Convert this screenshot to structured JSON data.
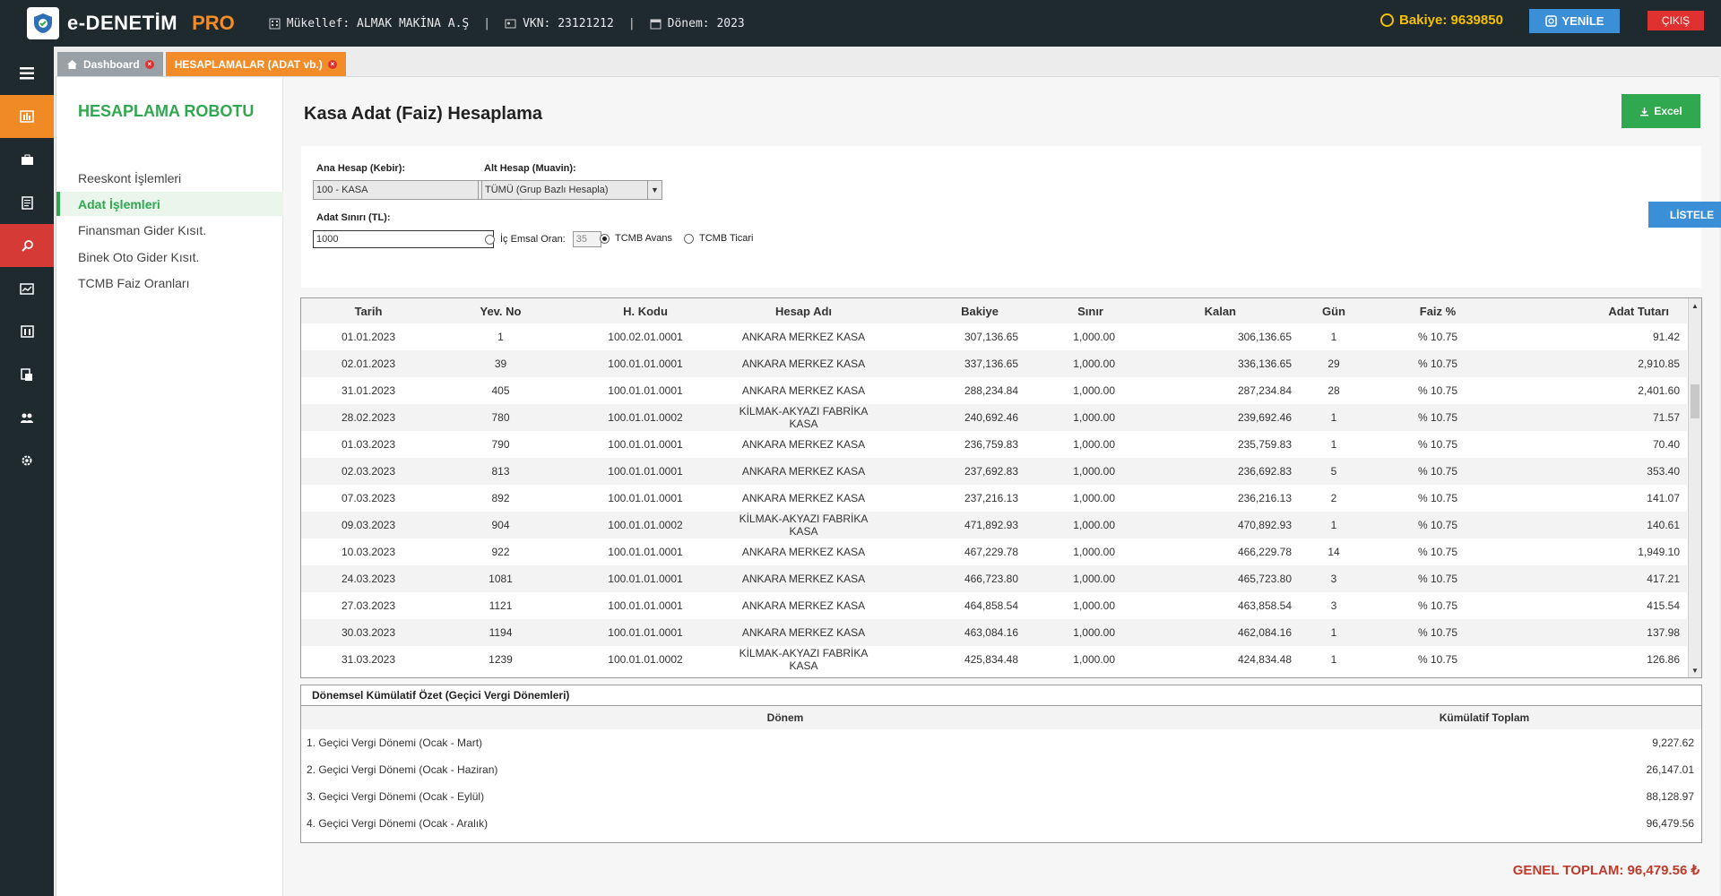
{
  "topbar": {
    "brand": "e-DENETİM",
    "pro": "PRO",
    "mukellef": "Mükellef: ALMAK MAKİNA A.Ş",
    "vkn": "VKN: 23121212",
    "donem": "Dönem: 2023",
    "sep": "|",
    "bakiye": "Bakiye: 9639850",
    "yenile": "YENİLE",
    "cikis": "ÇIKIŞ"
  },
  "tabs": [
    {
      "label": "Dashboard"
    },
    {
      "label": "HESAPLAMALAR (ADAT vb.)"
    }
  ],
  "sidebar": {
    "title": "HESAPLAMA ROBOTU",
    "items": [
      {
        "label": "Reeskont İşlemleri"
      },
      {
        "label": "Adat İşlemleri"
      },
      {
        "label": "Finansman Gider Kısıt."
      },
      {
        "label": "Binek Oto Gider Kısıt."
      },
      {
        "label": "TCMB Faiz Oranları"
      }
    ]
  },
  "main": {
    "title": "Kasa Adat (Faiz) Hesaplama",
    "excel_label": "Excel",
    "listele_label": "LİSTELE"
  },
  "filters": {
    "ana_hesap_label": "Ana Hesap (Kebir):",
    "ana_hesap_value": "100 - KASA",
    "alt_hesap_label": "Alt Hesap (Muavin):",
    "alt_hesap_value": "TÜMÜ (Grup Bazlı Hesapla)",
    "adat_siniri_label": "Adat Sınırı (TL):",
    "adat_siniri_value": "1000",
    "ic_emsal_label": "İç Emsal Oran:",
    "ic_emsal_value": "35",
    "tcmb_avans_label": "TCMB Avans",
    "tcmb_ticari_label": "TCMB Ticari",
    "selected_rate": "TCMB Avans"
  },
  "table": {
    "headers": [
      "Tarih",
      "Yev. No",
      "H. Kodu",
      "Hesap Adı",
      "Bakiye",
      "Sınır",
      "Kalan",
      "Gün",
      "Faiz %",
      "Adat Tutarı"
    ],
    "rows": [
      [
        "01.01.2023",
        "1",
        "100.02.01.0001",
        "ANKARA MERKEZ KASA",
        "307,136.65",
        "1,000.00",
        "306,136.65",
        "1",
        "% 10.75",
        "91.42"
      ],
      [
        "02.01.2023",
        "39",
        "100.01.01.0001",
        "ANKARA MERKEZ KASA",
        "337,136.65",
        "1,000.00",
        "336,136.65",
        "29",
        "% 10.75",
        "2,910.85"
      ],
      [
        "31.01.2023",
        "405",
        "100.01.01.0001",
        "ANKARA MERKEZ KASA",
        "288,234.84",
        "1,000.00",
        "287,234.84",
        "28",
        "% 10.75",
        "2,401.60"
      ],
      [
        "28.02.2023",
        "780",
        "100.01.01.0002",
        "KİLMAK-AKYAZI FABRİKA KASA",
        "240,692.46",
        "1,000.00",
        "239,692.46",
        "1",
        "% 10.75",
        "71.57"
      ],
      [
        "01.03.2023",
        "790",
        "100.01.01.0001",
        "ANKARA MERKEZ KASA",
        "236,759.83",
        "1,000.00",
        "235,759.83",
        "1",
        "% 10.75",
        "70.40"
      ],
      [
        "02.03.2023",
        "813",
        "100.01.01.0001",
        "ANKARA MERKEZ KASA",
        "237,692.83",
        "1,000.00",
        "236,692.83",
        "5",
        "% 10.75",
        "353.40"
      ],
      [
        "07.03.2023",
        "892",
        "100.01.01.0001",
        "ANKARA MERKEZ KASA",
        "237,216.13",
        "1,000.00",
        "236,216.13",
        "2",
        "% 10.75",
        "141.07"
      ],
      [
        "09.03.2023",
        "904",
        "100.01.01.0002",
        "KİLMAK-AKYAZI FABRİKA KASA",
        "471,892.93",
        "1,000.00",
        "470,892.93",
        "1",
        "% 10.75",
        "140.61"
      ],
      [
        "10.03.2023",
        "922",
        "100.01.01.0001",
        "ANKARA MERKEZ KASA",
        "467,229.78",
        "1,000.00",
        "466,229.78",
        "14",
        "% 10.75",
        "1,949.10"
      ],
      [
        "24.03.2023",
        "1081",
        "100.01.01.0001",
        "ANKARA MERKEZ KASA",
        "466,723.80",
        "1,000.00",
        "465,723.80",
        "3",
        "% 10.75",
        "417.21"
      ],
      [
        "27.03.2023",
        "1121",
        "100.01.01.0001",
        "ANKARA MERKEZ KASA",
        "464,858.54",
        "1,000.00",
        "463,858.54",
        "3",
        "% 10.75",
        "415.54"
      ],
      [
        "30.03.2023",
        "1194",
        "100.01.01.0001",
        "ANKARA MERKEZ KASA",
        "463,084.16",
        "1,000.00",
        "462,084.16",
        "1",
        "% 10.75",
        "137.98"
      ],
      [
        "31.03.2023",
        "1239",
        "100.01.01.0002",
        "KİLMAK-AKYAZI FABRİKA KASA",
        "425,834.48",
        "1,000.00",
        "424,834.48",
        "1",
        "% 10.75",
        "126.86"
      ]
    ]
  },
  "summary": {
    "title": "Dönemsel Kümülatif Özet (Geçici Vergi Dönemleri)",
    "headers": [
      "Dönem",
      "Kümülatif Toplam"
    ],
    "rows": [
      [
        "1. Geçici Vergi Dönemi (Ocak - Mart)",
        "9,227.62"
      ],
      [
        "2. Geçici Vergi Dönemi (Ocak - Haziran)",
        "26,147.01"
      ],
      [
        "3. Geçici Vergi Dönemi (Ocak - Eylül)",
        "88,128.97"
      ],
      [
        "4. Geçici Vergi Dönemi (Ocak - Aralık)",
        "96,479.56"
      ]
    ],
    "genel_toplam": "GENEL TOPLAM: 96,479.56 ₺"
  },
  "colors": {
    "topbar": "#1f2a2f",
    "accent_orange": "#f28c28",
    "accent_green": "#2fa84f",
    "accent_blue": "#3a8fd6",
    "danger_red": "#e03131",
    "bakiye_yellow": "#f5c000"
  },
  "icons": {
    "rail": [
      "menu-icon",
      "chart-icon",
      "briefcase-icon",
      "document-icon",
      "search-icon",
      "trend-icon",
      "building-icon",
      "invoice-icon",
      "users-icon",
      "settings-icon"
    ]
  }
}
